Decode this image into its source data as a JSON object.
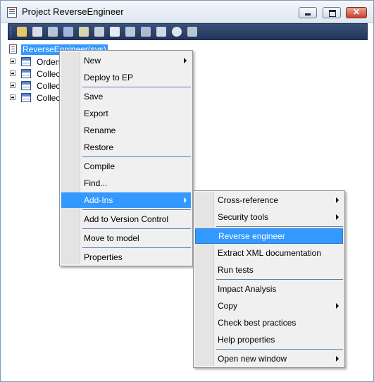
{
  "window": {
    "title": "Project ReverseEngineer"
  },
  "tree": {
    "root": "ReverseEngineer(sys)",
    "nodes": [
      "Orders",
      "Collec",
      "Collec",
      "Collec"
    ]
  },
  "context_menu": {
    "new": "New",
    "deploy": "Deploy to EP",
    "save": "Save",
    "export": "Export",
    "rename": "Rename",
    "restore": "Restore",
    "compile": "Compile",
    "find": "Find...",
    "addins": "Add-Ins",
    "add_version_control": "Add to Version Control",
    "move_to_model": "Move to model",
    "properties": "Properties"
  },
  "addins_menu": {
    "cross_reference": "Cross-reference",
    "security_tools": "Security tools",
    "reverse_engineer": "Reverse engineer",
    "extract_xml": "Extract XML documentation",
    "run_tests": "Run tests",
    "impact_analysis": "Impact Analysis",
    "copy": "Copy",
    "check_best_practices": "Check best practices",
    "help_properties": "Help properties",
    "open_new_window": "Open new window"
  },
  "colors": {
    "selection": "#3399ff",
    "toolbar": "#2c4268"
  }
}
